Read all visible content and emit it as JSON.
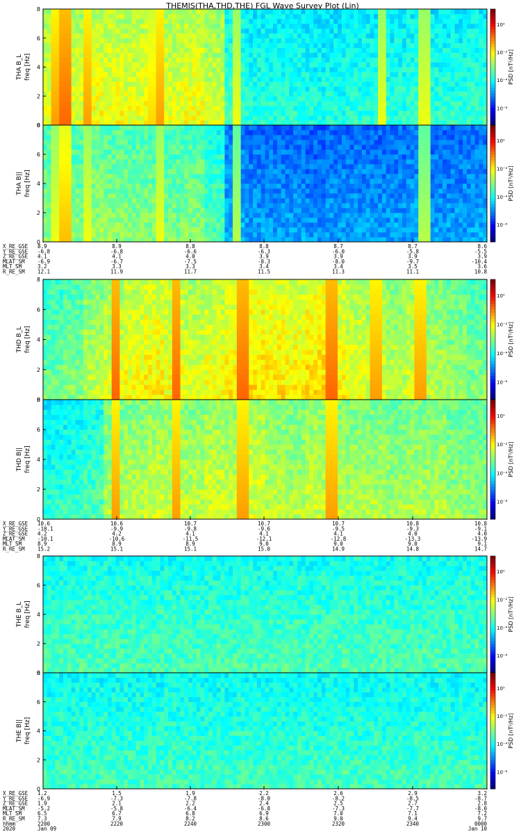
{
  "title": "THEMIS(THA,THD,THE) FGL Wave Survey Plot (Lin)",
  "ylabel_unit": "freq [Hz]",
  "colorbar_label": "PSD [nT²/Hz]",
  "colorbar_ticks": [
    "10⁰",
    "10⁻²",
    "10⁻⁴",
    "10⁻⁶"
  ],
  "chart_data": [
    {
      "type": "heatmap",
      "panel": "THA B_L",
      "ylabel": "THA B_L",
      "ylim": [
        0,
        8
      ],
      "yticks": [
        "0",
        "2",
        "4",
        "6",
        "8"
      ],
      "base_log_psd": [
        -3.2,
        -3.2,
        -3.0,
        -3.0,
        -3.1,
        -3.0,
        -3.1,
        -3.0,
        -3.3,
        -4.6,
        -4.8,
        -4.8,
        -4.8,
        -4.9,
        -4.9,
        -4.8,
        -4.8,
        -4.8,
        -4.7,
        -4.8,
        -4.8,
        -4.7
      ],
      "bursts": [
        [
          "22:03",
          -1.5
        ],
        [
          "22:06",
          -1.0
        ],
        [
          "22:12",
          -1.5
        ],
        [
          "22:30",
          -2.0
        ],
        [
          "22:32",
          -1.5
        ],
        [
          "22:52",
          -2.5
        ],
        [
          "23:32",
          -2.5
        ],
        [
          "23:43",
          -2.5
        ]
      ]
    },
    {
      "type": "heatmap",
      "panel": "THA B||",
      "ylabel": "THA B||",
      "ylim": [
        0,
        8
      ],
      "yticks": [
        "0",
        "2",
        "4",
        "6",
        "8"
      ],
      "base_log_psd": [
        -4.0,
        -4.0,
        -3.8,
        -3.9,
        -4.0,
        -4.0,
        -4.1,
        -4.0,
        -4.5,
        -5.8,
        -6.0,
        -6.0,
        -6.0,
        -6.1,
        -6.0,
        -6.0,
        -6.0,
        -6.0,
        -5.9,
        -6.0,
        -6.0,
        -5.9
      ],
      "bursts": [
        [
          "22:03",
          -2.5
        ],
        [
          "22:06",
          -1.8
        ],
        [
          "22:12",
          -2.5
        ],
        [
          "22:32",
          -2.5
        ],
        [
          "22:52",
          -3.0
        ],
        [
          "23:43",
          -3.0
        ]
      ]
    },
    {
      "type": "heatmap",
      "panel": "THD B_L",
      "ylabel": "THD B_L",
      "ylim": [
        0,
        8
      ],
      "yticks": [
        "0",
        "2",
        "4",
        "6",
        "8"
      ],
      "base_log_psd": [
        -4.2,
        -4.0,
        -3.5,
        -3.2,
        -3.0,
        -2.8,
        -3.0,
        -3.2,
        -3.0,
        -2.8,
        -2.6,
        -2.7,
        -2.8,
        -2.6,
        -2.9,
        -3.1,
        -3.3,
        -3.5,
        -3.3,
        -3.6,
        -3.8,
        -4.0
      ],
      "bursts": [
        [
          "22:20",
          -1.0
        ],
        [
          "22:36",
          -1.0
        ],
        [
          "22:54",
          -1.0
        ],
        [
          "23:18",
          -1.0
        ],
        [
          "23:30",
          -1.5
        ],
        [
          "23:42",
          -1.5
        ]
      ]
    },
    {
      "type": "heatmap",
      "panel": "THD B||",
      "ylabel": "THD B||",
      "ylim": [
        0,
        8
      ],
      "yticks": [
        "0",
        "2",
        "4",
        "6",
        "8"
      ],
      "base_log_psd": [
        -4.8,
        -4.7,
        -4.5,
        -3.6,
        -3.5,
        -3.4,
        -3.4,
        -3.5,
        -3.3,
        -3.4,
        -3.2,
        -3.5,
        -3.6,
        -3.4,
        -3.5,
        -3.6,
        -3.6,
        -3.7,
        -3.6,
        -3.6,
        -3.8,
        -3.9
      ],
      "bursts": [
        [
          "22:20",
          -1.5
        ],
        [
          "22:36",
          -1.5
        ],
        [
          "22:54",
          -1.5
        ],
        [
          "23:18",
          -1.5
        ]
      ]
    },
    {
      "type": "heatmap",
      "panel": "THE B_L",
      "ylabel": "THE B_L",
      "ylim": [
        0,
        8
      ],
      "yticks": [
        "0",
        "2",
        "4",
        "6",
        "8"
      ],
      "base_log_psd": [
        -4.5,
        -4.5,
        -4.5,
        -4.5,
        -4.5,
        -4.5,
        -4.5,
        -4.5,
        -4.5,
        -4.5,
        -4.5,
        -4.5,
        -4.5,
        -4.5,
        -4.5,
        -4.5,
        -4.5,
        -4.5,
        -4.5,
        -4.5,
        -4.5,
        -4.5
      ],
      "bursts": []
    },
    {
      "type": "heatmap",
      "panel": "THE B||",
      "ylabel": "THE B||",
      "ylim": [
        0,
        8
      ],
      "yticks": [
        "0",
        "2",
        "4",
        "6",
        "8"
      ],
      "base_log_psd": [
        -4.6,
        -4.6,
        -4.6,
        -4.6,
        -4.6,
        -4.6,
        -4.6,
        -4.6,
        -4.6,
        -4.6,
        -4.6,
        -4.6,
        -4.6,
        -4.6,
        -4.6,
        -4.6,
        -4.6,
        -4.6,
        -4.6,
        -4.6,
        -4.6,
        -4.6
      ],
      "bursts": []
    }
  ],
  "ephemeris": [
    {
      "probe": "THA",
      "labels": [
        "X_RE_GSE",
        "Y_RE_GSE",
        "Z_RE_GSE",
        "MLAT_SM",
        "MLT_SM",
        "R_RE_SM"
      ],
      "columns": [
        [
          "8.9",
          "-6.8",
          "4.1",
          "-6.9",
          "3.2",
          "12.1"
        ],
        [
          "8.9",
          "-6.8",
          "4.1",
          "-6.7",
          "3.3",
          "11.9"
        ],
        [
          "8.8",
          "-6.6",
          "4.0",
          "-7.5",
          "3.3",
          "11.7"
        ],
        [
          "8.8",
          "-6.3",
          "3.9",
          "-8.3",
          "3.4",
          "11.5"
        ],
        [
          "8.7",
          "-6.0",
          "3.9",
          "-8.0",
          "3.4",
          "11.3"
        ],
        [
          "8.7",
          "-5.8",
          "3.9",
          "-9.7",
          "3.5",
          "11.1"
        ],
        [
          "8.6",
          "-5.5",
          "3.9",
          "-10.4",
          "3.6",
          "10.8"
        ]
      ]
    },
    {
      "probe": "THD",
      "labels": [
        "X_RE_GSE",
        "Y_RE_GSE",
        "Z_RE_GSE",
        "MLAT_SM",
        "MLT_SM",
        "R_RE_SM"
      ],
      "columns": [
        [
          "10.6",
          "-10.1",
          "4.2",
          "-10.1",
          "8.9",
          "15.2"
        ],
        [
          "10.6",
          "-9.9",
          "4.2",
          "-10.6",
          "8.9",
          "15.1"
        ],
        [
          "10.7",
          "-9.8",
          "4.1",
          "-11.5",
          "8.9",
          "15.1"
        ],
        [
          "10.7",
          "-9.6",
          "4.1",
          "-12.1",
          "9.0",
          "15.0"
        ],
        [
          "10.7",
          "-9.5",
          "4.1",
          "-12.8",
          "9.0",
          "14.9"
        ],
        [
          "10.8",
          "-9.3",
          "4.0",
          "-13.3",
          "9.0",
          "14.8"
        ],
        [
          "10.8",
          "-9.1",
          "4.0",
          "-13.9",
          "9.1",
          "14.7"
        ]
      ]
    },
    {
      "probe": "THE",
      "labels": [
        "X_RE_GSE",
        "Y_RE_GSE",
        "Z_RE_GSE",
        "MLAT_SM",
        "MLT_SM",
        "R_RE_SM",
        "hhmm",
        "2020"
      ],
      "columns": [
        [
          "1.2",
          "-6.9",
          "1.9",
          "-5.2",
          "6.5",
          "7.3",
          "2200",
          "Jan 09"
        ],
        [
          "1.5",
          "-7.3",
          "2.1",
          "-5.8",
          "6.7",
          "7.9",
          "2220",
          ""
        ],
        [
          "1.9",
          "-7.8",
          "2.2",
          "-6.4",
          "6.8",
          "8.2",
          "2240",
          ""
        ],
        [
          "2.2",
          "-8.0",
          "2.4",
          "-6.8",
          "6.9",
          "8.6",
          "2300",
          ""
        ],
        [
          "2.6",
          "-8.2",
          "2.5",
          "-7.3",
          "7.0",
          "9.0",
          "2320",
          ""
        ],
        [
          "2.9",
          "-8.5",
          "2.7",
          "-7.7",
          "7.1",
          "9.4",
          "2340",
          ""
        ],
        [
          "3.2",
          "-8.7",
          "2.8",
          "-8.0",
          "7.2",
          "9.7",
          "0000",
          "Jan 10"
        ]
      ]
    }
  ]
}
